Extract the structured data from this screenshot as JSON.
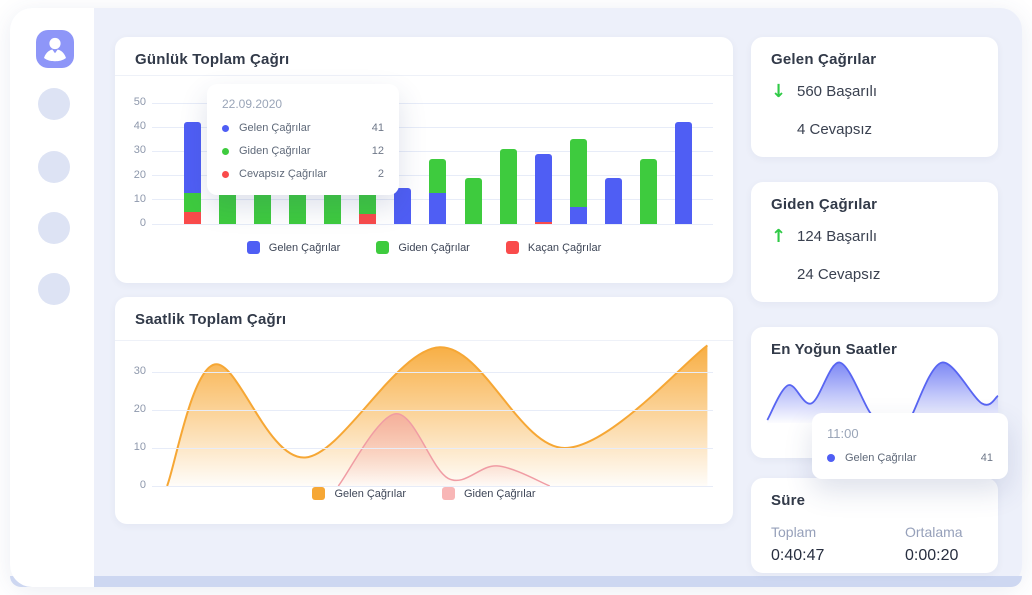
{
  "colors": {
    "window_bg": "#edf0fa",
    "card_bg": "#ffffff",
    "sidebar_bg": "#ffffff",
    "accent_blue": "#4f5ef4",
    "green": "#3ecb3e",
    "red": "#f94b4b",
    "orange": "#f6a735",
    "pink": "#f5a8ab",
    "wave_blue": "#5865f2",
    "logo_bg": "#8e96f8",
    "success_green": "#2fca46"
  },
  "sidebar": {
    "logo_icon": "support-agent-icon",
    "nav_placeholders": 4
  },
  "daily": {
    "title": "Günlük Toplam Çağrı",
    "y_ticks": [
      "50",
      "40",
      "30",
      "20",
      "10",
      "0"
    ],
    "legend": [
      {
        "label": "Gelen Çağrılar",
        "color": "#4f5ef4"
      },
      {
        "label": "Giden Çağrılar",
        "color": "#3ecb3e"
      },
      {
        "label": "Kaçan Çağrılar",
        "color": "#f94b4b"
      }
    ],
    "tooltip": {
      "date": "22.09.2020",
      "rows": [
        {
          "label": "Gelen Çağrılar",
          "value": "41",
          "color": "#4f5ef4"
        },
        {
          "label": "Giden Çağrılar",
          "value": "12",
          "color": "#3ecb3e"
        },
        {
          "label": "Cevapsız Çağrılar",
          "value": "2",
          "color": "#f94b4b"
        }
      ]
    }
  },
  "hourly": {
    "title": "Saatlik Toplam Çağrı",
    "y_ticks": [
      "30",
      "20",
      "10",
      "0"
    ],
    "legend": [
      {
        "label": "Gelen Çağrılar",
        "color": "#f6a735"
      },
      {
        "label": "Giden Çağrılar",
        "color": "#f8b6b6"
      }
    ]
  },
  "busiest": {
    "title": "En Yoğun Saatler",
    "tooltip": {
      "time": "11:00",
      "rows": [
        {
          "label": "Gelen Çağrılar",
          "value": "41",
          "color": "#4f5ef4"
        }
      ]
    }
  },
  "incoming_card": {
    "title": "Gelen Çağrılar",
    "arrow": "↓",
    "success": "560 Başarılı",
    "missed": "4 Cevapsız"
  },
  "outgoing_card": {
    "title": "Giden Çağrılar",
    "arrow": "↑",
    "success": "124 Başarılı",
    "missed": "24 Cevapsız"
  },
  "duration_card": {
    "title": "Süre",
    "columns": [
      {
        "label": "Toplam",
        "value": "0:40:47"
      },
      {
        "label": "Ortalama",
        "value": "0:00:20"
      }
    ]
  },
  "chart_data": [
    {
      "type": "bar",
      "stacked": true,
      "title": "Günlük Toplam Çağrı",
      "ylim": [
        0,
        50
      ],
      "y_ticks": [
        50,
        40,
        30,
        20,
        10,
        0
      ],
      "x_tick_labels_shown": false,
      "grid": true,
      "legend_position": "bottom",
      "categories": [
        "1",
        "2",
        "3",
        "4",
        "5",
        "6",
        "7",
        "8",
        "9",
        "10",
        "11",
        "12",
        "13",
        "14",
        "15"
      ],
      "series_colors": {
        "Gelen Çağrılar": "#4f5ef4",
        "Giden Çağrılar": "#3ecb3e",
        "Kaçan Çağrılar": "#f94b4b"
      },
      "bars_bottom_to_top": [
        [
          [
            "Kaçan Çağrılar",
            5
          ],
          [
            "Giden Çağrılar",
            8
          ],
          [
            "Gelen Çağrılar",
            29
          ]
        ],
        [
          [
            "Giden Çağrılar",
            22
          ]
        ],
        [
          [
            "Giden Çağrılar",
            25
          ]
        ],
        [
          [
            "Giden Çağrılar",
            23
          ]
        ],
        [
          [
            "Giden Çağrılar",
            24
          ]
        ],
        [
          [
            "Kaçan Çağrılar",
            4
          ],
          [
            "Giden Çağrılar",
            31
          ]
        ],
        [
          [
            "Gelen Çağrılar",
            15
          ]
        ],
        [
          [
            "Gelen Çağrılar",
            13
          ],
          [
            "Giden Çağrılar",
            14
          ]
        ],
        [
          [
            "Giden Çağrılar",
            19
          ]
        ],
        [
          [
            "Giden Çağrılar",
            31
          ]
        ],
        [
          [
            "Kaçan Çağrılar",
            1
          ],
          [
            "Gelen Çağrılar",
            28
          ]
        ],
        [
          [
            "Gelen Çağrılar",
            7
          ],
          [
            "Giden Çağrılar",
            28
          ]
        ],
        [
          [
            "Gelen Çağrılar",
            19
          ]
        ],
        [
          [
            "Giden Çağrılar",
            27
          ]
        ],
        [
          [
            "Gelen Çağrılar",
            42
          ]
        ]
      ],
      "note": "bars 2-5 are partially hidden behind the tooltip; their heights are estimated"
    },
    {
      "type": "area",
      "title": "Saatlik Toplam Çağrı",
      "ylim": [
        0,
        38
      ],
      "y_ticks": [
        30,
        20,
        10,
        0
      ],
      "x_tick_labels_shown": false,
      "grid": true,
      "legend_position": "bottom",
      "series": [
        {
          "name": "Gelen Çağrılar",
          "color": "#f6a735",
          "points": [
            [
              0.027,
              0
            ],
            [
              0.112,
              32
            ],
            [
              0.273,
              7.5
            ],
            [
              0.513,
              36.5
            ],
            [
              0.736,
              10
            ],
            [
              0.99,
              37
            ]
          ]
        },
        {
          "name": "Giden Çağrılar",
          "color": "#f09ca4",
          "points": [
            [
              0.332,
              0
            ],
            [
              0.435,
              19
            ],
            [
              0.528,
              2
            ],
            [
              0.615,
              5.3
            ],
            [
              0.709,
              0
            ]
          ]
        }
      ]
    },
    {
      "type": "area",
      "title": "En Yoğun Saatler",
      "ylim": [
        0,
        43
      ],
      "grid": false,
      "series": [
        {
          "name": "Gelen Çağrılar",
          "color": "#5865f2",
          "segments": [
            [
              [
                0.01,
                2
              ],
              [
                0.1,
                25
              ],
              [
                0.2,
                13
              ],
              [
                0.32,
                40
              ],
              [
                0.45,
                7
              ],
              [
                0.5,
                1
              ]
            ],
            [
              [
                0.63,
                5
              ],
              [
                0.76,
                40
              ],
              [
                0.93,
                13
              ],
              [
                1.0,
                18
              ]
            ]
          ]
        }
      ],
      "highlight": {
        "x_label": "11:00",
        "series": "Gelen Çağrılar",
        "value": 41
      }
    }
  ]
}
